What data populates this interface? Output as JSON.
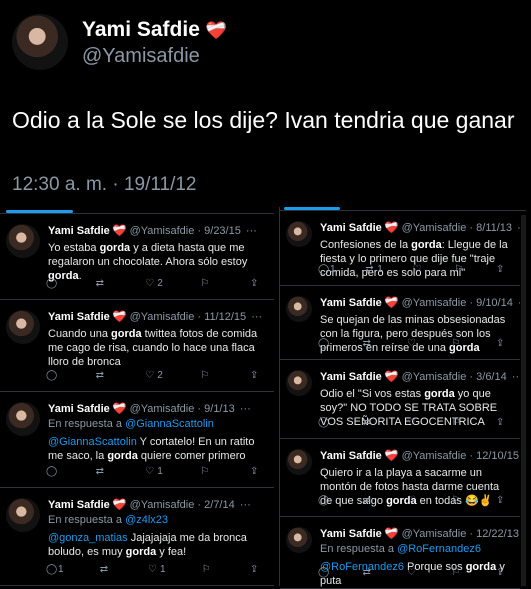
{
  "main": {
    "name": "Yami Safdie",
    "handle": "@Yamisafdie",
    "heart": "❤️‍🩹",
    "text": "Odio a la Sole se los dije? Ivan tendria que ganar",
    "timestamp": "12:30 a. m. · 19/11/12"
  },
  "left": [
    {
      "name": "Yami Safdie",
      "handle": "@Yamisafdie",
      "date": "· 9/23/15",
      "text_parts": [
        "Yo estaba ",
        "gorda",
        " y a dieta hasta que me regalaron un chocolate. Ahora sólo estoy ",
        "gorda",
        "."
      ],
      "likes": "2"
    },
    {
      "name": "Yami Safdie",
      "handle": "@Yamisafdie",
      "date": "· 11/12/15",
      "text_parts": [
        "Cuando una ",
        "gorda",
        " twittea fotos de comida me cago de risa, cuando lo hace una flaca lloro de bronca"
      ],
      "likes": "2"
    },
    {
      "name": "Yami Safdie",
      "handle": "@Yamisafdie",
      "date": "· 9/1/13",
      "reply_prefix": "En respuesta a ",
      "reply_to": "@GiannaScattolin",
      "mention": "@GiannaScattolin",
      "text_parts": [
        " Y cortatelo! En un ratito me saco, la ",
        "gorda",
        " quiere comer primero"
      ],
      "likes": "1"
    },
    {
      "name": "Yami Safdie",
      "handle": "@Yamisafdie",
      "date": "· 2/7/14",
      "reply_prefix": "En respuesta a ",
      "reply_to": "@z4lx23",
      "mention": "@gonza_matias",
      "text_parts": [
        " Jajajajaja me da bronca boludo, es muy ",
        "gorda",
        " y fea!"
      ],
      "replies": "1",
      "likes": "1"
    }
  ],
  "right": [
    {
      "name": "Yami Safdie",
      "handle": "@Yamisafdie",
      "date": "· 8/11/13",
      "text_parts": [
        "Confesiones de la ",
        "gorda",
        ": Llegue de la fiesta y lo primero que dije fue \"traje comida, pero es solo para mi\""
      ],
      "replies": "1",
      "retweets": "1"
    },
    {
      "name": "Yami Safdie",
      "handle": "@Yamisafdie",
      "date": "· 9/10/14",
      "text_parts": [
        "Se quejan de las minas obsesionadas con la figura, pero después son los primeros en reírse de una ",
        "gorda"
      ]
    },
    {
      "name": "Yami Safdie",
      "handle": "@Yamisafdie",
      "date": "· 3/6/14",
      "text_parts": [
        "Odio el \"Si vos estas ",
        "gorda",
        " yo que soy?\" NO TODO SE TRATA SOBRE VOS SEÑORITA EGOCENTRICA"
      ]
    },
    {
      "name": "Yami Safdie",
      "handle": "@Yamisafdie",
      "date": "· 12/10/15",
      "text_parts": [
        "Quiero ir a la playa a sacarme un montón de fotos hasta darme cuenta de que salgo ",
        "gorda",
        " en todas 😂✌️"
      ]
    },
    {
      "name": "Yami Safdie",
      "handle": "@Yamisafdie",
      "date": "· 12/22/13",
      "reply_prefix": "En respuesta a ",
      "reply_to": "@RoFernandez6",
      "mention": "@RoFernandez6",
      "text_parts": [
        " Porque sos ",
        "gorda",
        " y puta"
      ]
    }
  ],
  "icons": {
    "reply": "reply-icon",
    "retweet": "retweet-icon",
    "like": "heart-icon",
    "bookmark": "bookmark-icon",
    "share": "share-icon"
  }
}
